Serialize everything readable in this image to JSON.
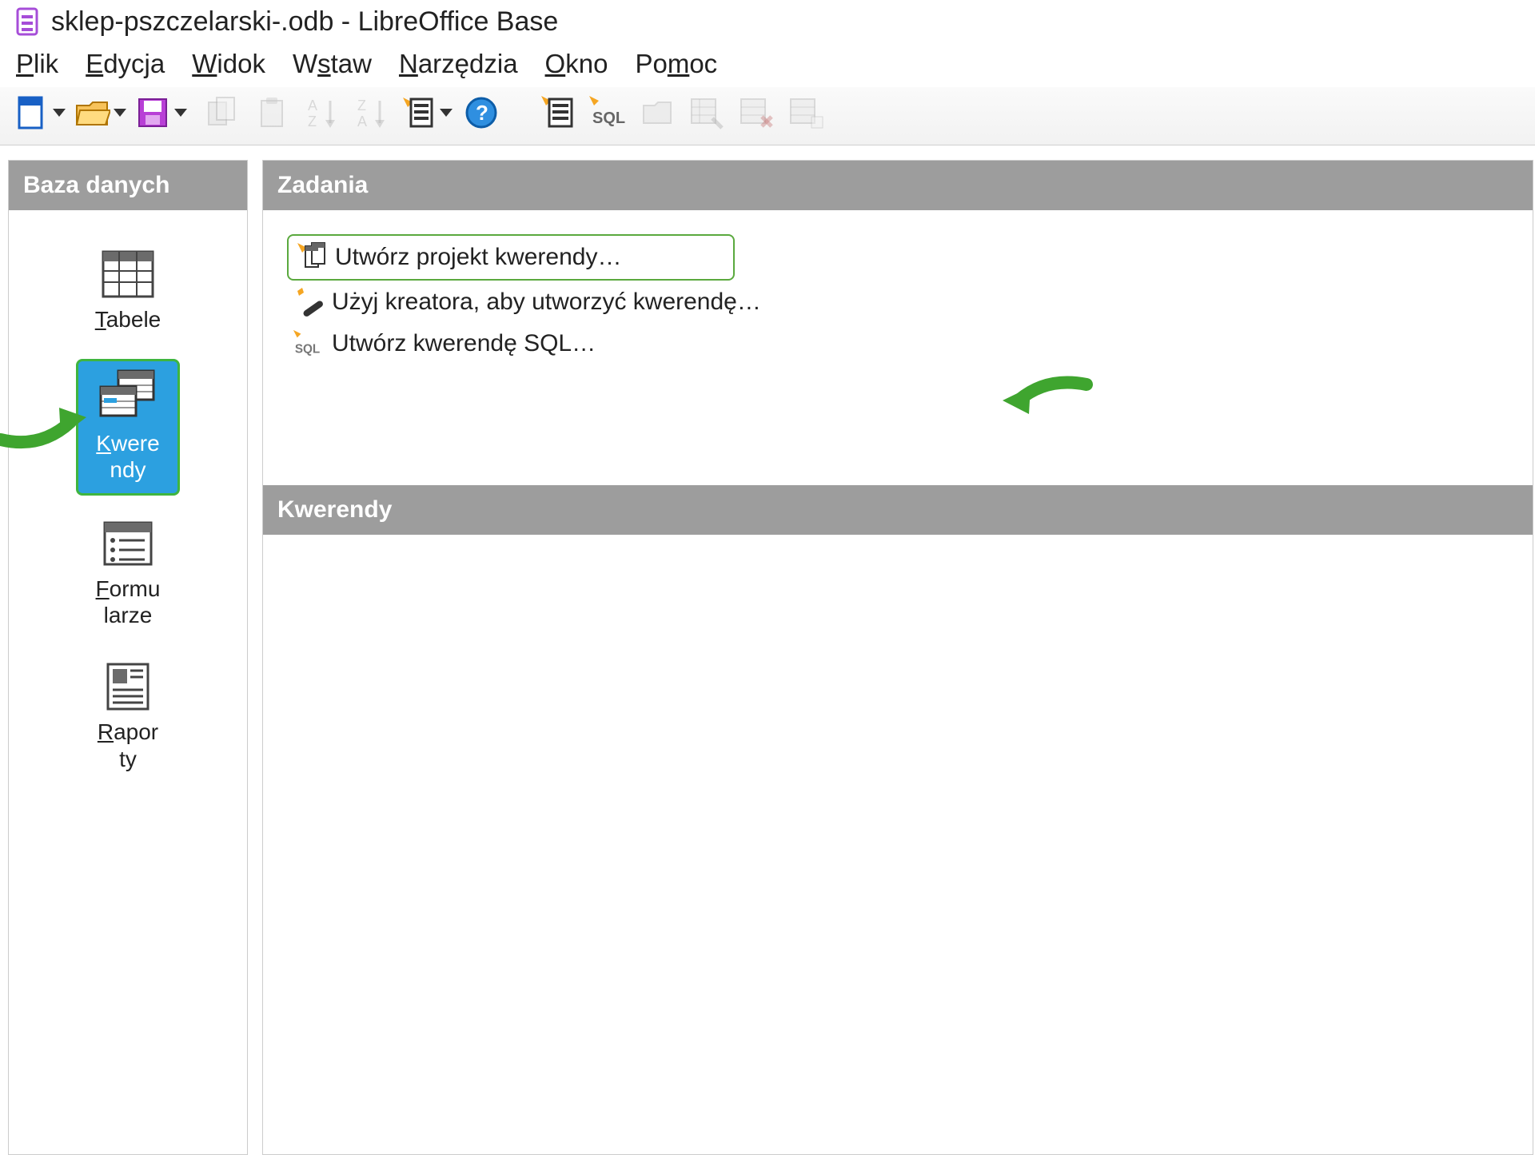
{
  "window": {
    "title": "sklep-pszczelarski-.odb - LibreOffice Base"
  },
  "menu": {
    "plik": "Plik",
    "edycja": "Edycja",
    "widok": "Widok",
    "wstaw": "Wstaw",
    "narzedzia": "Narzędzia",
    "okno": "Okno",
    "pomoc": "Pomoc"
  },
  "sidebar": {
    "header": "Baza danych",
    "items": {
      "tabele": "Tabele",
      "kwerendy1": "Kwere",
      "kwerendy2": "ndy",
      "formularze1": "Formu",
      "formularze2": "larze",
      "raporty1": "Rapor",
      "raporty2": "ty"
    }
  },
  "tasks": {
    "header": "Zadania",
    "create_query_design": "Utwórz projekt kwerendy…",
    "use_wizard": "Użyj kreatora, aby utworzyć kwerendę…",
    "create_sql": "Utwórz kwerendę SQL…"
  },
  "queries": {
    "header": "Kwerendy"
  }
}
